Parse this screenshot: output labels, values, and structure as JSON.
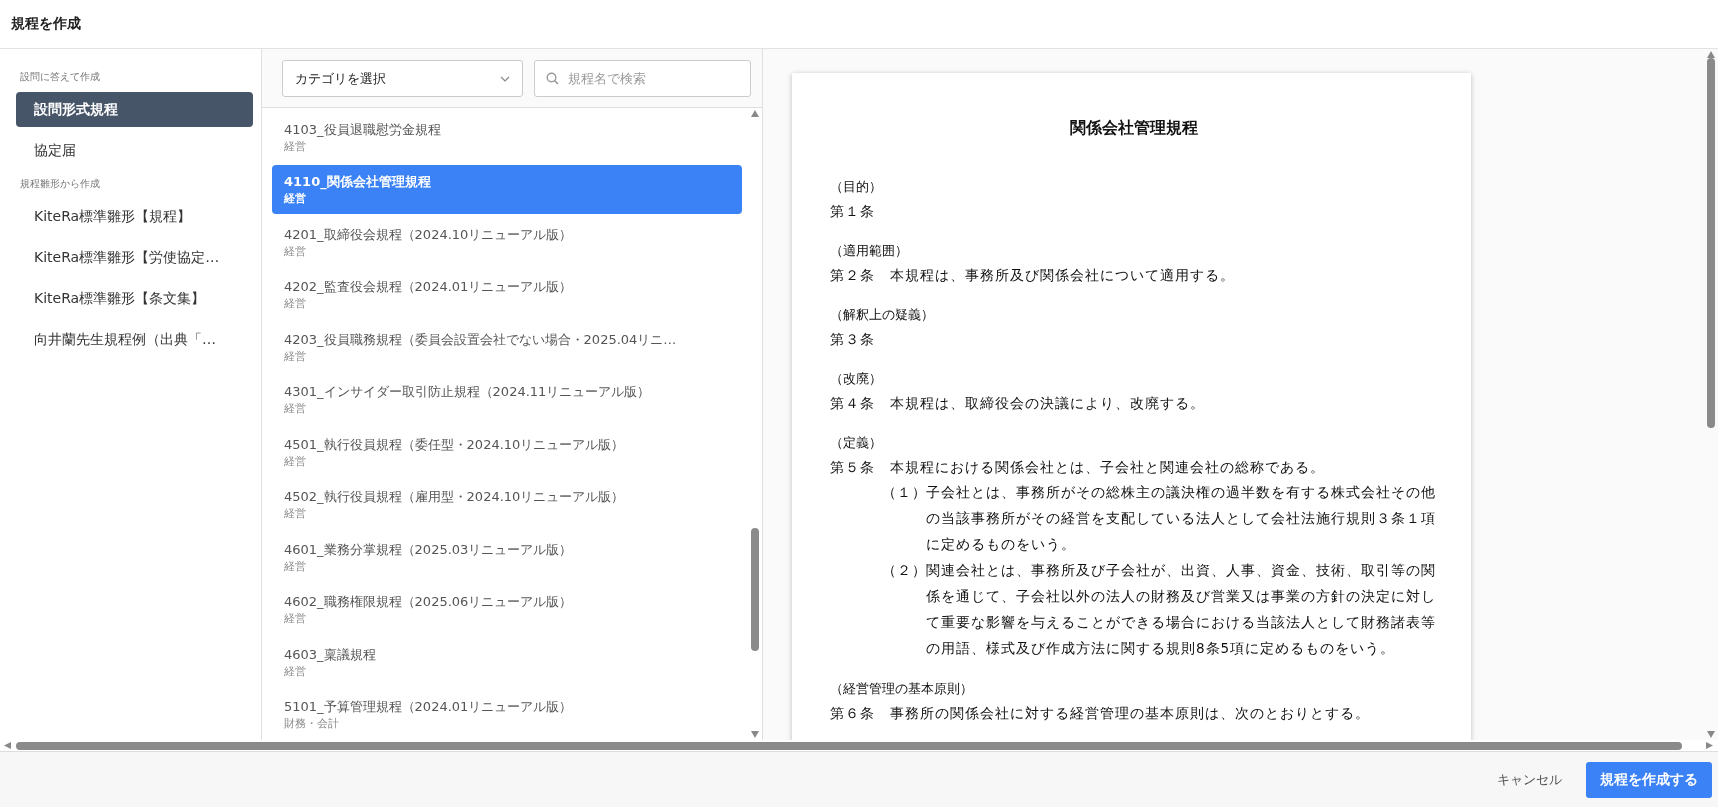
{
  "window": {
    "title": "規程を作成"
  },
  "sidebar": {
    "sections": [
      {
        "label": "設問に答えて作成",
        "items": [
          {
            "label": "設問形式規程",
            "selected": true
          },
          {
            "label": "協定届",
            "selected": false
          }
        ]
      },
      {
        "label": "規程雛形から作成",
        "items": [
          {
            "label": "KiteRa標準雛形【規程】",
            "selected": false
          },
          {
            "label": "KiteRa標準雛形【労使協定…",
            "selected": false
          },
          {
            "label": "KiteRa標準雛形【条文集】",
            "selected": false
          },
          {
            "label": "向井蘭先生規程例（出典「…",
            "selected": false
          }
        ]
      }
    ]
  },
  "filters": {
    "category": {
      "value": "カテゴリを選択"
    },
    "search": {
      "placeholder": "規程名で検索"
    }
  },
  "templates": [
    {
      "name": "4103_役員退職慰労金規程",
      "category": "経営",
      "selected": false
    },
    {
      "name": "4110_関係会社管理規程",
      "category": "経営",
      "selected": true
    },
    {
      "name": "4201_取締役会規程（2024.10リニューアル版）",
      "category": "経営",
      "selected": false
    },
    {
      "name": "4202_監査役会規程（2024.01リニューアル版）",
      "category": "経営",
      "selected": false
    },
    {
      "name": "4203_役員職務規程（委員会設置会社でない場合・2025.04リニ…",
      "category": "経営",
      "selected": false
    },
    {
      "name": "4301_インサイダー取引防止規程（2024.11リニューアル版）",
      "category": "経営",
      "selected": false
    },
    {
      "name": "4501_執行役員規程（委任型・2024.10リニューアル版）",
      "category": "経営",
      "selected": false
    },
    {
      "name": "4502_執行役員規程（雇用型・2024.10リニューアル版）",
      "category": "経営",
      "selected": false
    },
    {
      "name": "4601_業務分掌規程（2025.03リニューアル版）",
      "category": "経営",
      "selected": false
    },
    {
      "name": "4602_職務権限規程（2025.06リニューアル版）",
      "category": "経営",
      "selected": false
    },
    {
      "name": "4603_稟議規程",
      "category": "経営",
      "selected": false
    },
    {
      "name": "5101_予算管理規程（2024.01リニューアル版）",
      "category": "財務・会計",
      "selected": false
    }
  ],
  "preview": {
    "title": "関係会社管理規程",
    "articles": [
      {
        "caption": "（目的）",
        "text": "第１条"
      },
      {
        "caption": "（適用範囲）",
        "text": "第２条　本規程は、事務所及び関係会社について適用する。"
      },
      {
        "caption": "（解釈上の疑義）",
        "text": "第３条"
      },
      {
        "caption": "（改廃）",
        "text": "第４条　本規程は、取締役会の決議により、改廃する。"
      },
      {
        "caption": "（定義）",
        "text": "第５条　本規程における関係会社とは、子会社と関連会社の総称である。",
        "items": [
          {
            "label": "（１）",
            "text": "子会社とは、事務所がその総株主の議決権の過半数を有する株式会社その他の当該事務所がその経営を支配している法人として会社法施行規則３条１項に定めるものをいう。"
          },
          {
            "label": "（２）",
            "text": "関連会社とは、事務所及び子会社が、出資、人事、資金、技術、取引等の関係を通じて、子会社以外の法人の財務及び営業又は事業の方針の決定に対して重要な影響を与えることができる場合における当該法人として財務諸表等の用語、様式及び作成方法に関する規則8条5項に定めるものをいう。"
          }
        ]
      },
      {
        "caption": "（経営管理の基本原則）",
        "text": "第６条　事務所の関係会社に対する経営管理の基本原則は、次のとおりとする。"
      }
    ]
  },
  "footer": {
    "cancel": "キャンセル",
    "submit": "規程を作成する"
  }
}
